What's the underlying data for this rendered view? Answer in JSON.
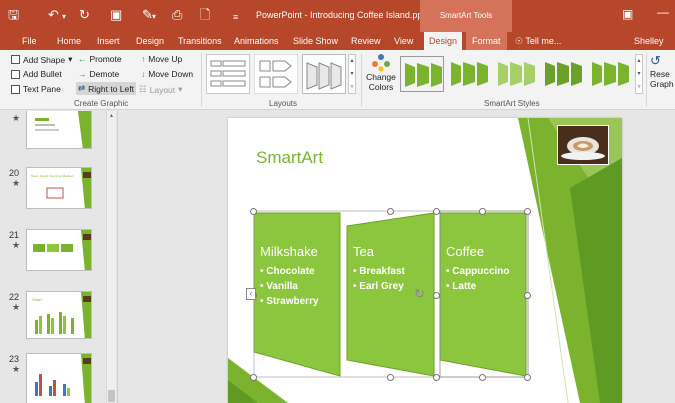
{
  "titlebar": {
    "doc_title": "PowerPoint - Introducing Coffee Island.ppt...",
    "context_group": "SmartArt Tools"
  },
  "tabs": [
    "File",
    "Home",
    "Insert",
    "Design",
    "Transitions",
    "Animations",
    "Slide Show",
    "Review",
    "View",
    "Design",
    "Format",
    "Tell me...",
    "Shelley Fish"
  ],
  "ribbon": {
    "create_graphic": {
      "add_shape": "Add Shape",
      "add_bullet": "Add Bullet",
      "text_pane": "Text Pane",
      "promote": "Promote",
      "demote": "Demote",
      "right_to_left": "Right to Left",
      "move_up": "Move Up",
      "move_down": "Move Down",
      "layout": "Layout",
      "label": "Create Graphic"
    },
    "layouts_label": "Layouts",
    "change_colors_line1": "Change",
    "change_colors_line2": "Colors",
    "styles_label": "SmartArt Styles",
    "reset_line1": "Rese",
    "reset_line2": "Graph"
  },
  "thumbnails": [
    {
      "num": "",
      "star": "★"
    },
    {
      "num": "20",
      "star": "★",
      "text": "Team: Grand Opening (Mockup)"
    },
    {
      "num": "21",
      "star": "★"
    },
    {
      "num": "22",
      "star": "★",
      "text": "Chart"
    },
    {
      "num": "23",
      "star": "★"
    }
  ],
  "slide": {
    "title": "SmartArt",
    "columns": [
      {
        "title": "Milkshake",
        "items": [
          "Chocolate",
          "Vanilla",
          "Strawberry"
        ]
      },
      {
        "title": "Tea",
        "items": [
          "Breakfast",
          "Earl Grey"
        ]
      },
      {
        "title": "Coffee",
        "items": [
          "Cappuccino",
          "Latte"
        ]
      }
    ]
  },
  "colors": {
    "ppt_red": "#b7472a",
    "context_tab": "#d5735a",
    "accent_green": "#7bb32e",
    "shape_green": "#8cc63e"
  }
}
